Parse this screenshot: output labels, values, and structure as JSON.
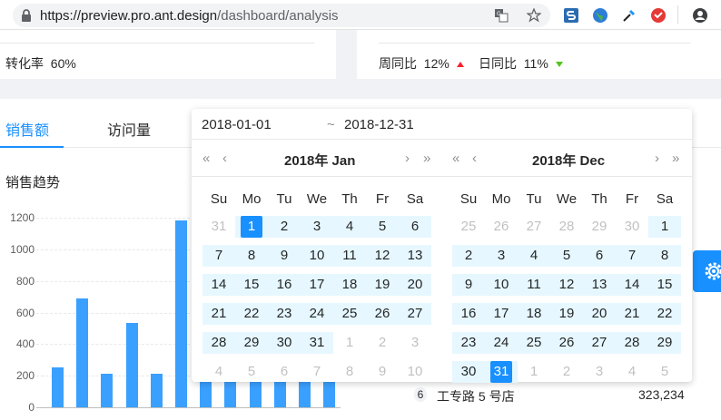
{
  "browser": {
    "url_prefix": "https://preview.pro.ant.design",
    "url_path": "/dashboard/analysis"
  },
  "stats": {
    "conversion_label": "转化率",
    "conversion_value": "60%",
    "wow_label": "周同比",
    "wow_value": "12%",
    "dod_label": "日同比",
    "dod_value": "11%"
  },
  "tabs": [
    {
      "label": "销售额"
    },
    {
      "label": "访问量"
    }
  ],
  "chart_data": {
    "type": "bar",
    "title": "销售趋势",
    "yticks": [
      "0",
      "200",
      "400",
      "600",
      "800",
      "1000",
      "1200"
    ],
    "ylim": [
      0,
      1200
    ],
    "values": [
      255,
      690,
      215,
      535,
      215,
      1180,
      160,
      160,
      160,
      160,
      160,
      160
    ],
    "color": "#3aa0ff"
  },
  "ranking": {
    "rank": "6",
    "name": "工专路 5 号店",
    "value": "323,234"
  },
  "picker": {
    "start": "2018-01-01",
    "separator": "~",
    "end": "2018-12-31",
    "nav": {
      "prev_year": "«",
      "prev_month": "‹",
      "next_month": "›",
      "next_year": "»"
    },
    "weekdays": [
      "Su",
      "Mo",
      "Tu",
      "We",
      "Th",
      "Fr",
      "Sa"
    ],
    "left": {
      "title": "2018年 Jan",
      "days": [
        "31",
        "1",
        "2",
        "3",
        "4",
        "5",
        "6",
        "7",
        "8",
        "9",
        "10",
        "11",
        "12",
        "13",
        "14",
        "15",
        "16",
        "17",
        "18",
        "19",
        "20",
        "21",
        "22",
        "23",
        "24",
        "25",
        "26",
        "27",
        "28",
        "29",
        "30",
        "31",
        "1",
        "2",
        "3",
        "4",
        "5",
        "6",
        "7",
        "8",
        "9",
        "10"
      ],
      "first_in_month": 1,
      "last_in_month": 31,
      "selected": 1
    },
    "right": {
      "title": "2018年 Dec",
      "days": [
        "25",
        "26",
        "27",
        "28",
        "29",
        "30",
        "1",
        "2",
        "3",
        "4",
        "5",
        "6",
        "7",
        "8",
        "9",
        "10",
        "11",
        "12",
        "13",
        "14",
        "15",
        "16",
        "17",
        "18",
        "19",
        "20",
        "21",
        "22",
        "23",
        "24",
        "25",
        "26",
        "27",
        "28",
        "29",
        "30",
        "31",
        "1",
        "2",
        "3",
        "4",
        "5"
      ],
      "first_in_month": 6,
      "last_in_month": 36,
      "selected": 36
    }
  },
  "colors": {
    "primary": "#1890ff",
    "range_bg": "#e6f7ff",
    "up": "#f5222d",
    "down": "#52c41a"
  }
}
